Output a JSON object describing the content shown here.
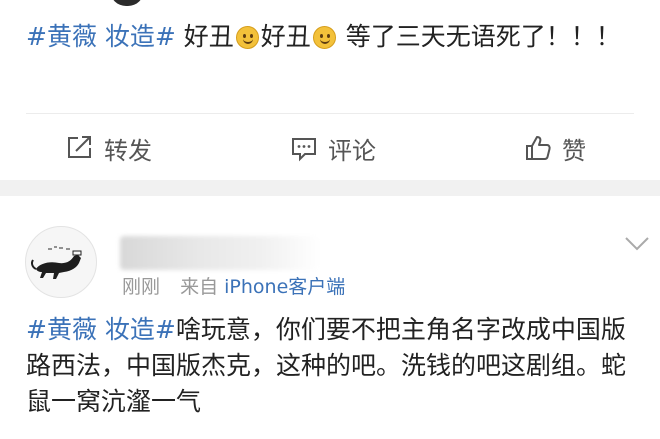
{
  "colors": {
    "link": "#3b72b8",
    "text": "#222222",
    "muted": "#999999",
    "divider": "#f1f1f1"
  },
  "post1": {
    "tag": "#黄薇 妆造#",
    "text_a": " 好丑",
    "emoji_1": "smile-emoji",
    "text_b": "好丑",
    "emoji_2": "smile-emoji",
    "text_c": "  等了三天无语死了！！！"
  },
  "actions": {
    "repost": {
      "label": "转发",
      "icon": "repost-icon"
    },
    "comment": {
      "label": "评论",
      "icon": "comment-icon"
    },
    "like": {
      "label": "赞",
      "icon": "thumbs-up-icon"
    }
  },
  "post2": {
    "username": "",
    "time": "刚刚",
    "source_prefix": "来自",
    "source": "iPhone客户端",
    "tag": "#黄薇 妆造#",
    "text": "啥玩意，你们要不把主角名字改成中国版路西法，中国版杰克，这种的吧。洗钱的吧这剧组。蛇鼠一窝沆瀣一气"
  }
}
